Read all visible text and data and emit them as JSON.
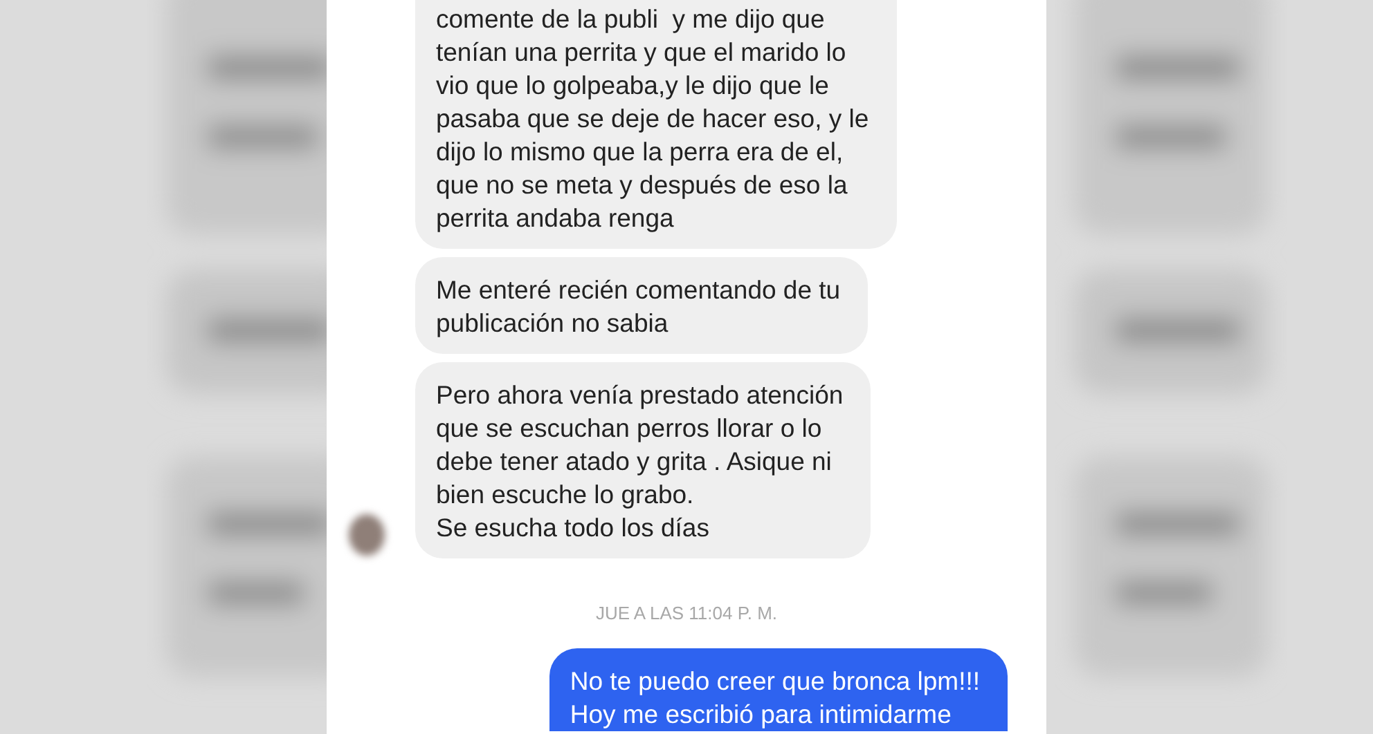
{
  "messages": [
    {
      "kind": "received",
      "cut_top": true,
      "text": "comente de la publi  y me dijo que\ntenían una perrita y que el marido lo\nvio que lo golpeaba,y le dijo que le\npasaba que se deje de hacer eso, y le\ndijo lo mismo que la perra era de el,\nque no se meta y después de eso la\nperrita andaba renga"
    },
    {
      "kind": "received",
      "text": "Me enteré recién comentando de tu\npublicación no sabia"
    },
    {
      "kind": "received",
      "avatar": true,
      "text": "Pero ahora venía prestado atención\nque se escuchan perros llorar o lo\ndebe tener atado y grita . Asique ni\nbien escuche lo grabo.\nSe esucha todo los días"
    },
    {
      "kind": "timestamp",
      "text": "JUE A LAS 11:04 P. M."
    },
    {
      "kind": "sent",
      "cut_bottom": true,
      "text": "No te puedo creer que bronca lpm!!!\nHoy me escribió para intimidarme"
    }
  ]
}
